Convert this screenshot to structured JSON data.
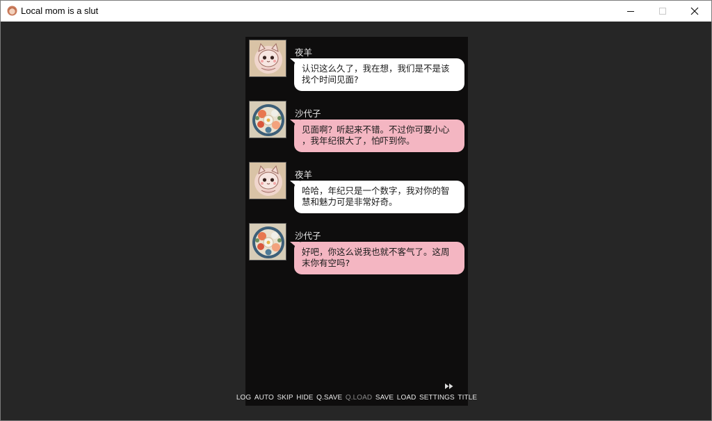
{
  "window": {
    "title": "Local mom is a slut",
    "app_icon": "app-portrait-icon",
    "controls": [
      "minimize-icon",
      "maximize-icon",
      "close-icon"
    ]
  },
  "chat": {
    "messages": [
      {
        "speaker": "夜羊",
        "text_line1": "认识这么久了，我在想，我们是不是该",
        "text_line2": "找个时间见面?",
        "bubble_color": "#ffffff",
        "avatar": "cat-avatar-icon"
      },
      {
        "speaker": "沙代子",
        "text_line1": "见面啊？听起来不错。不过你可要小心",
        "text_line2": "，我年纪很大了，怕吓到你。",
        "bubble_color": "#f4b6c2",
        "avatar": "flower-avatar-icon"
      },
      {
        "speaker": "夜羊",
        "text_line1": "哈哈，年纪只是一个数字，我对你的智",
        "text_line2": "慧和魅力可是非常好奇。",
        "bubble_color": "#ffffff",
        "avatar": "cat-avatar-icon"
      },
      {
        "speaker": "沙代子",
        "text_line1": "好吧，你这么说我也就不客气了。这周",
        "text_line2": "末你有空吗?",
        "bubble_color": "#f4b6c2",
        "avatar": "flower-avatar-icon"
      }
    ]
  },
  "quick_menu": {
    "skip_indicator_icon": "fast-forward-icon",
    "items": [
      {
        "label": "LOG",
        "enabled": true
      },
      {
        "label": "AUTO",
        "enabled": true
      },
      {
        "label": "SKIP",
        "enabled": true
      },
      {
        "label": "HIDE",
        "enabled": true
      },
      {
        "label": "Q.SAVE",
        "enabled": true
      },
      {
        "label": "Q.LOAD",
        "enabled": false
      },
      {
        "label": "SAVE",
        "enabled": true
      },
      {
        "label": "LOAD",
        "enabled": true
      },
      {
        "label": "SETTINGS",
        "enabled": true
      },
      {
        "label": "TITLE",
        "enabled": true
      }
    ]
  }
}
